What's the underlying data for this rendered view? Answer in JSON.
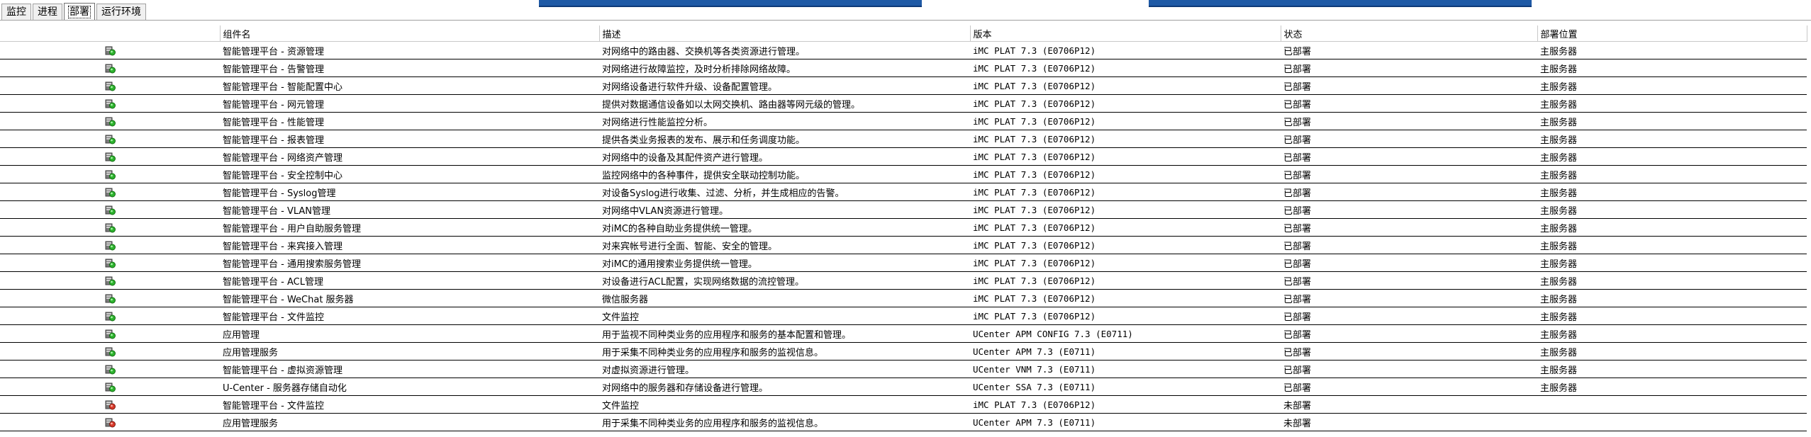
{
  "tabs": [
    "监控",
    "进程",
    "部署",
    "运行环境"
  ],
  "active_tab": 2,
  "columns": [
    "",
    "组件名",
    "描述",
    "版本",
    "状态",
    "部署位置"
  ],
  "rows": [
    {
      "icon": "deployed-component-icon",
      "name": "智能管理平台 - 资源管理",
      "desc": "对网络中的路由器、交换机等各类资源进行管理。",
      "ver": "iMC PLAT 7.3 (E0706P12)",
      "status": "已部署",
      "loc": "主服务器"
    },
    {
      "icon": "deployed-component-icon",
      "name": "智能管理平台 - 告警管理",
      "desc": "对网络进行故障监控，及时分析排除网络故障。",
      "ver": "iMC PLAT 7.3 (E0706P12)",
      "status": "已部署",
      "loc": "主服务器"
    },
    {
      "icon": "deployed-component-icon",
      "name": "智能管理平台 - 智能配置中心",
      "desc": "对网络设备进行软件升级、设备配置管理。",
      "ver": "iMC PLAT 7.3 (E0706P12)",
      "status": "已部署",
      "loc": "主服务器"
    },
    {
      "icon": "deployed-component-icon",
      "name": "智能管理平台 - 网元管理",
      "desc": "提供对数据通信设备如以太网交换机、路由器等网元级的管理。",
      "ver": "iMC PLAT 7.3 (E0706P12)",
      "status": "已部署",
      "loc": "主服务器"
    },
    {
      "icon": "deployed-component-icon",
      "name": "智能管理平台 - 性能管理",
      "desc": "对网络进行性能监控分析。",
      "ver": "iMC PLAT 7.3 (E0706P12)",
      "status": "已部署",
      "loc": "主服务器"
    },
    {
      "icon": "deployed-component-icon",
      "name": "智能管理平台 - 报表管理",
      "desc": "提供各类业务报表的发布、展示和任务调度功能。",
      "ver": "iMC PLAT 7.3 (E0706P12)",
      "status": "已部署",
      "loc": "主服务器"
    },
    {
      "icon": "deployed-component-icon",
      "name": "智能管理平台 - 网络资产管理",
      "desc": "对网络中的设备及其配件资产进行管理。",
      "ver": "iMC PLAT 7.3 (E0706P12)",
      "status": "已部署",
      "loc": "主服务器"
    },
    {
      "icon": "deployed-component-icon",
      "name": "智能管理平台 - 安全控制中心",
      "desc": "监控网络中的各种事件，提供安全联动控制功能。",
      "ver": "iMC PLAT 7.3 (E0706P12)",
      "status": "已部署",
      "loc": "主服务器"
    },
    {
      "icon": "deployed-component-icon",
      "name": "智能管理平台 - Syslog管理",
      "desc": "对设备Syslog进行收集、过滤、分析，并生成相应的告警。",
      "ver": "iMC PLAT 7.3 (E0706P12)",
      "status": "已部署",
      "loc": "主服务器"
    },
    {
      "icon": "deployed-component-icon",
      "name": "智能管理平台 - VLAN管理",
      "desc": "对网络中VLAN资源进行管理。",
      "ver": "iMC PLAT 7.3 (E0706P12)",
      "status": "已部署",
      "loc": "主服务器"
    },
    {
      "icon": "deployed-component-icon",
      "name": "智能管理平台 - 用户自助服务管理",
      "desc": "对iMC的各种自助业务提供统一管理。",
      "ver": "iMC PLAT 7.3 (E0706P12)",
      "status": "已部署",
      "loc": "主服务器"
    },
    {
      "icon": "deployed-component-icon",
      "name": "智能管理平台 - 来宾接入管理",
      "desc": "对来宾帐号进行全面、智能、安全的管理。",
      "ver": "iMC PLAT 7.3 (E0706P12)",
      "status": "已部署",
      "loc": "主服务器"
    },
    {
      "icon": "deployed-component-icon",
      "name": "智能管理平台 - 通用搜索服务管理",
      "desc": "对iMC的通用搜索业务提供统一管理。",
      "ver": "iMC PLAT 7.3 (E0706P12)",
      "status": "已部署",
      "loc": "主服务器"
    },
    {
      "icon": "deployed-component-icon",
      "name": "智能管理平台 - ACL管理",
      "desc": "对设备进行ACL配置，实现网络数据的流控管理。",
      "ver": "iMC PLAT 7.3 (E0706P12)",
      "status": "已部署",
      "loc": "主服务器"
    },
    {
      "icon": "deployed-component-icon",
      "name": "智能管理平台 - WeChat 服务器",
      "desc": "微信服务器",
      "ver": "iMC PLAT 7.3 (E0706P12)",
      "status": "已部署",
      "loc": "主服务器"
    },
    {
      "icon": "deployed-component-icon",
      "name": "智能管理平台 - 文件监控",
      "desc": "文件监控",
      "ver": "iMC PLAT 7.3 (E0706P12)",
      "status": "已部署",
      "loc": "主服务器"
    },
    {
      "icon": "deployed-component-icon",
      "name": "应用管理",
      "desc": "用于监视不同种类业务的应用程序和服务的基本配置和管理。",
      "ver": "UCenter APM CONFIG 7.3 (E0711)",
      "status": "已部署",
      "loc": "主服务器"
    },
    {
      "icon": "deployed-component-icon",
      "name": "应用管理服务",
      "desc": "用于采集不同种类业务的应用程序和服务的监视信息。",
      "ver": "UCenter APM 7.3 (E0711)",
      "status": "已部署",
      "loc": "主服务器"
    },
    {
      "icon": "deployed-component-icon",
      "name": "智能管理平台 - 虚拟资源管理",
      "desc": "对虚拟资源进行管理。",
      "ver": "UCenter VNM 7.3 (E0711)",
      "status": "已部署",
      "loc": "主服务器"
    },
    {
      "icon": "deployed-component-icon",
      "name": "U-Center - 服务器存储自动化",
      "desc": "对网络中的服务器和存储设备进行管理。",
      "ver": "UCenter SSA 7.3 (E0711)",
      "status": "已部署",
      "loc": "主服务器"
    },
    {
      "icon": "undeployed-component-icon",
      "name": "智能管理平台 - 文件监控",
      "desc": "文件监控",
      "ver": "iMC PLAT 7.3 (E0706P12)",
      "status": "未部署",
      "loc": ""
    },
    {
      "icon": "undeployed-component-icon",
      "name": "应用管理服务",
      "desc": "用于采集不同种类业务的应用程序和服务的监视信息。",
      "ver": "UCenter APM 7.3 (E0711)",
      "status": "未部署",
      "loc": ""
    }
  ]
}
